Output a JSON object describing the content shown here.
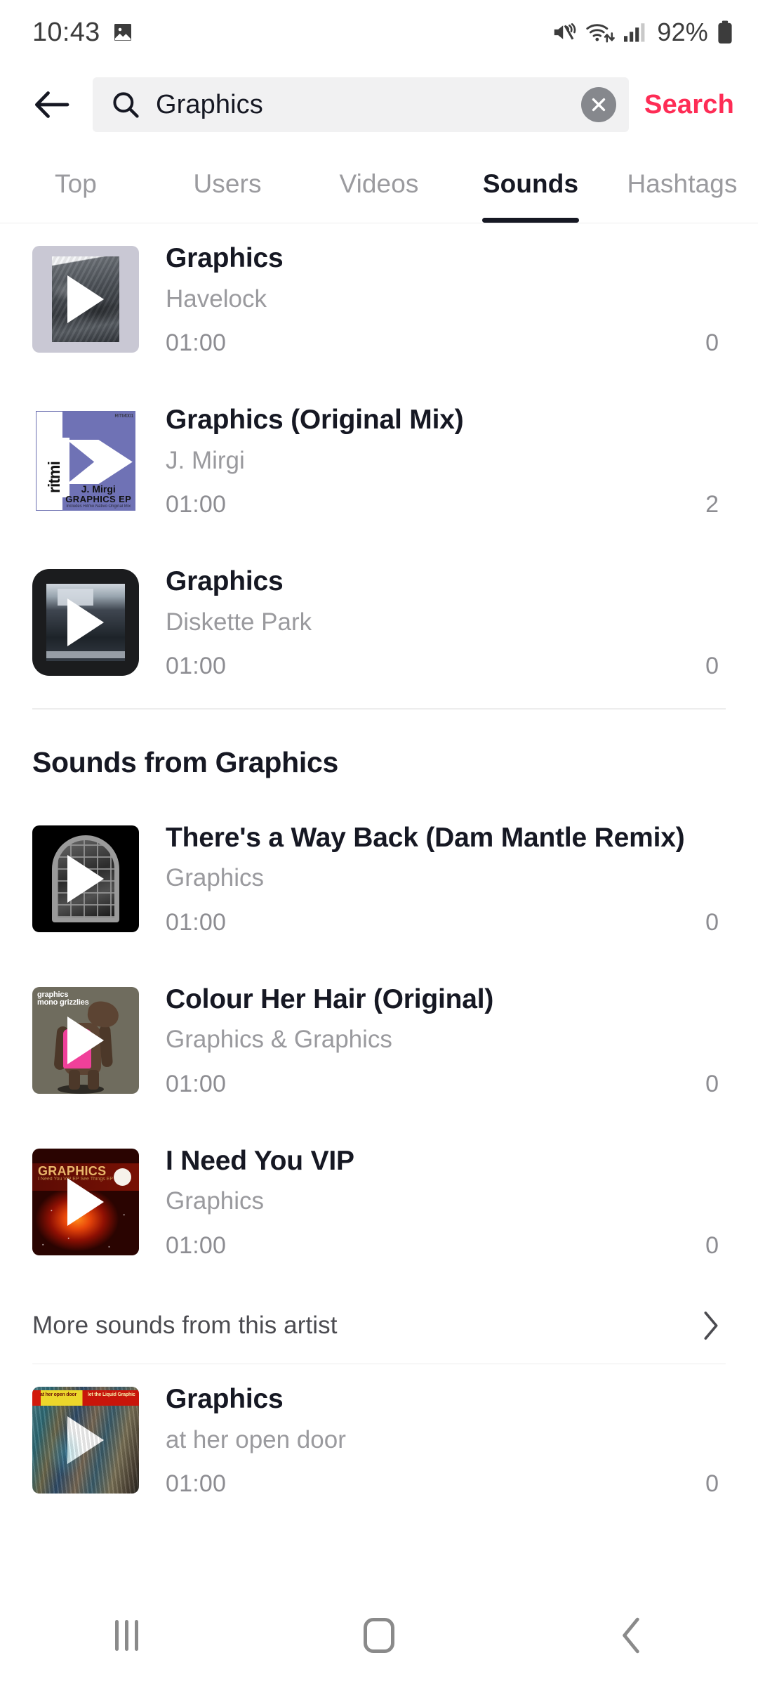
{
  "status_bar": {
    "time": "10:43",
    "battery_percent": "92%",
    "icons": [
      "image-icon",
      "mute-icon",
      "wifi-icon",
      "signal-icon",
      "battery-icon"
    ]
  },
  "header": {
    "back_icon": "back-arrow-icon",
    "search_icon": "search-icon",
    "query": "Graphics",
    "placeholder": "Search",
    "clear_icon": "clear-icon",
    "search_label": "Search",
    "accent_color": "#fe2c55"
  },
  "tabs": [
    {
      "label": "Top",
      "active": false
    },
    {
      "label": "Users",
      "active": false
    },
    {
      "label": "Videos",
      "active": false
    },
    {
      "label": "Sounds",
      "active": true
    },
    {
      "label": "Hashtags",
      "active": false
    }
  ],
  "results": [
    {
      "title": "Graphics",
      "artist": "Havelock",
      "duration": "01:00",
      "count": "0"
    },
    {
      "title": "Graphics (Original Mix)",
      "artist": "J. Mirgi",
      "duration": "01:00",
      "count": "2"
    },
    {
      "title": "Graphics",
      "artist": "Diskette Park",
      "duration": "01:00",
      "count": "0"
    }
  ],
  "section": {
    "heading": "Sounds from Graphics",
    "items": [
      {
        "title": "There's a Way Back (Dam Mantle Remix)",
        "artist": "Graphics",
        "duration": "01:00",
        "count": "0"
      },
      {
        "title": "Colour Her Hair (Original)",
        "artist": "Graphics & Graphics",
        "duration": "01:00",
        "count": "0"
      },
      {
        "title": "I Need You VIP",
        "artist": "Graphics",
        "duration": "01:00",
        "count": "0"
      }
    ],
    "more_label": "More sounds from this artist",
    "more_icon": "chevron-right-icon"
  },
  "trailing": {
    "title": "Graphics",
    "artist": "at her open door",
    "duration": "01:00",
    "count": "0"
  },
  "artwork": {
    "ritmi": {
      "label": "ritmi",
      "catalog": "RITM001",
      "artist": "J. Mirgi",
      "release": "GRAPHICS EP",
      "note": "Includes Ritmo Nativo Original Mix"
    },
    "bear": {
      "line1": "graphics",
      "line2": "mono grizzlies"
    },
    "nebula": {
      "title": "GRAPHICS",
      "sub": "I Need You VIP\nEP\nSee Things EP"
    },
    "door": {
      "left": "at her open door",
      "right": "let the Liquid Graphic"
    }
  },
  "navigation": {
    "recents_icon": "recents-icon",
    "home_icon": "home-icon",
    "back_icon": "nav-back-icon"
  }
}
